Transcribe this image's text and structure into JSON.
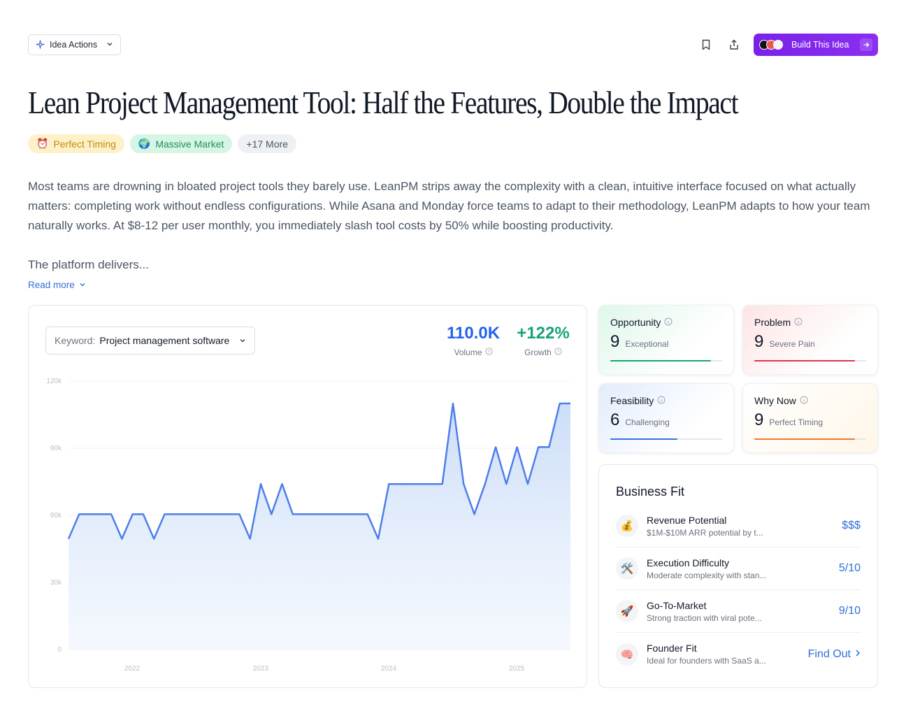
{
  "toolbar": {
    "idea_actions_label": "Idea Actions",
    "build_label": "Build This Idea"
  },
  "title": "Lean Project Management Tool: Half the Features, Double the Impact",
  "tags": [
    {
      "icon": "alarm-clock-icon",
      "label": "Perfect Timing"
    },
    {
      "icon": "globe-icon",
      "label": "Massive Market"
    },
    {
      "label": "+17 More"
    }
  ],
  "description": "Most teams are drowning in bloated project tools they barely use. LeanPM strips away the complexity with a clean, intuitive interface focused on what actually matters: completing work without endless configurations. While Asana and Monday force teams to adapt to their methodology, LeanPM adapts to how your team naturally works. At $8-12 per user monthly, you immediately slash tool costs by 50% while boosting productivity.",
  "description_more": "The platform delivers...",
  "read_more": "Read more",
  "keyword": {
    "label": "Keyword:",
    "value": "Project management software"
  },
  "metrics": {
    "volume": {
      "value": "110.0K",
      "label": "Volume"
    },
    "growth": {
      "value": "+122%",
      "label": "Growth"
    }
  },
  "colors": {
    "accent": "#2f6fdb",
    "line": "#4f7ee8",
    "purple": "#7a22e6",
    "green": "#16a37a",
    "red": "#e0344a",
    "blue": "#3b6fe0",
    "orange": "#f07a2a"
  },
  "chart_data": {
    "type": "area",
    "y_ticks": [
      "0",
      "30k",
      "60k",
      "90k",
      "120k"
    ],
    "ylim": [
      0,
      120000
    ],
    "x_ticks": [
      "2022",
      "2023",
      "2024",
      "2025"
    ],
    "values": [
      49500,
      60500,
      60500,
      60500,
      60500,
      49500,
      60500,
      60500,
      49500,
      60500,
      60500,
      60500,
      60500,
      60500,
      60500,
      60500,
      60500,
      49500,
      74000,
      60500,
      74000,
      60500,
      60500,
      60500,
      60500,
      60500,
      60500,
      60500,
      60500,
      49500,
      74000,
      74000,
      74000,
      74000,
      74000,
      74000,
      110000,
      74000,
      60500,
      74000,
      90500,
      74000,
      90500,
      74000,
      90500,
      90500,
      110000,
      110000
    ],
    "grid": true
  },
  "scores": [
    {
      "name": "Opportunity",
      "value": "9",
      "label": "Exceptional",
      "fraction": 0.9
    },
    {
      "name": "Problem",
      "value": "9",
      "label": "Severe Pain",
      "fraction": 0.9
    },
    {
      "name": "Feasibility",
      "value": "6",
      "label": "Challenging",
      "fraction": 0.6
    },
    {
      "name": "Why Now",
      "value": "9",
      "label": "Perfect Timing",
      "fraction": 0.9
    }
  ],
  "business_fit": {
    "title": "Business Fit",
    "rows": [
      {
        "icon": "money-bag-icon",
        "title": "Revenue Potential",
        "desc": "$1M-$10M ARR potential by t...",
        "value": "$$$"
      },
      {
        "icon": "tools-icon",
        "title": "Execution Difficulty",
        "desc": "Moderate complexity with stan...",
        "value": "5/10"
      },
      {
        "icon": "rocket-icon",
        "title": "Go-To-Market",
        "desc": "Strong traction with viral pote...",
        "value": "9/10"
      },
      {
        "icon": "brain-icon",
        "title": "Founder Fit",
        "desc": "Ideal for founders with SaaS a...",
        "value": "Find Out"
      }
    ]
  }
}
